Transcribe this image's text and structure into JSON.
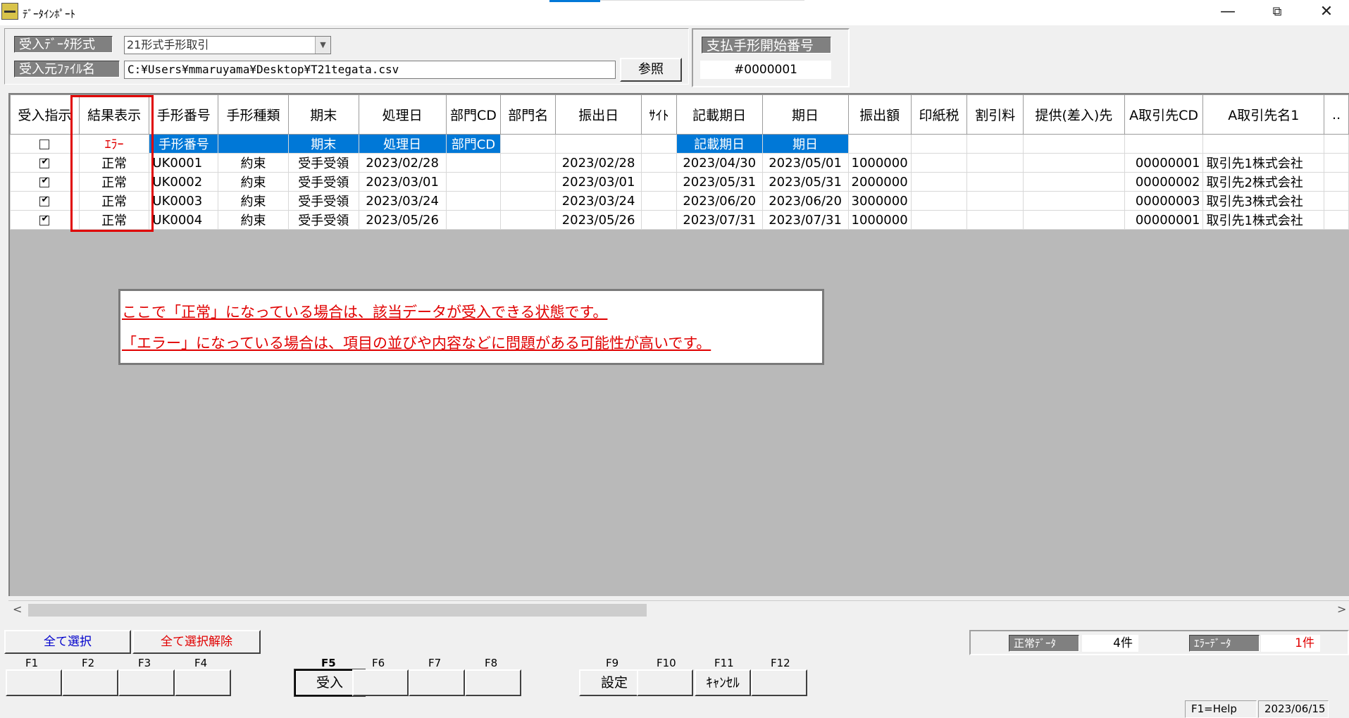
{
  "window": {
    "title": "ﾃﾞｰﾀｲﾝﾎﾟｰﾄ",
    "minimize": "—",
    "restore": "⧉",
    "close": "✕"
  },
  "header": {
    "format_label": "受入ﾃﾞｰﾀ形式",
    "format_value": "21形式手形取引",
    "file_label": "受入元ﾌｧｲﾙ名",
    "file_path": "C:¥Users¥mmaruyama¥Desktop¥T21tegata.csv",
    "browse_label": "参照",
    "start_no_label": "支払手形開始番号",
    "start_no_value": "#0000001"
  },
  "grid": {
    "columns": [
      "受入指示",
      "結果表示",
      "手形番号",
      "手形種類",
      "期末",
      "処理日",
      "部門CD",
      "部門名",
      "振出日",
      "ｻｲﾄ",
      "記載期日",
      "期日",
      "振出額",
      "印紙税",
      "割引料",
      "提供(差入)先",
      "A取引先CD",
      "A取引先名1",
      ".."
    ],
    "error_row": {
      "checked": false,
      "result": "ｴﾗｰ",
      "cells": [
        "手形番号",
        "",
        "期末",
        "処理日",
        "部門CD",
        "",
        "",
        "",
        "記載期日",
        "期日",
        "",
        "",
        "",
        "",
        "",
        "",
        ""
      ]
    },
    "rows": [
      {
        "checked": true,
        "result": "正常",
        "cells": [
          "UK0001",
          "約束",
          "受手受領",
          "2023/02/28",
          "",
          "",
          "2023/02/28",
          "",
          "2023/04/30",
          "2023/05/01",
          "1000000",
          "",
          "",
          "",
          "00000001",
          "取引先1株式会社",
          ""
        ]
      },
      {
        "checked": true,
        "result": "正常",
        "cells": [
          "UK0002",
          "約束",
          "受手受領",
          "2023/03/01",
          "",
          "",
          "2023/03/01",
          "",
          "2023/05/31",
          "2023/05/31",
          "2000000",
          "",
          "",
          "",
          "00000002",
          "取引先2株式会社",
          ""
        ]
      },
      {
        "checked": true,
        "result": "正常",
        "cells": [
          "UK0003",
          "約束",
          "受手受領",
          "2023/03/24",
          "",
          "",
          "2023/03/24",
          "",
          "2023/06/20",
          "2023/06/20",
          "3000000",
          "",
          "",
          "",
          "00000003",
          "取引先3株式会社",
          ""
        ]
      },
      {
        "checked": true,
        "result": "正常",
        "cells": [
          "UK0004",
          "約束",
          "受手受領",
          "2023/05/26",
          "",
          "",
          "2023/05/26",
          "",
          "2023/07/31",
          "2023/07/31",
          "1000000",
          "",
          "",
          "",
          "00000001",
          "取引先1株式会社",
          ""
        ]
      }
    ]
  },
  "note": {
    "line1": "ここで「正常」になっている場合は、該当データが受入できる状態です。",
    "line2": "「エラー」になっている場合は、項目の並びや内容などに問題がある可能性が高いです。"
  },
  "scroll": {
    "left_arrow": "<",
    "right_arrow": ">"
  },
  "footer": {
    "select_all": "全て選択",
    "deselect_all": "全て選択解除",
    "normal_label": "正常ﾃﾞｰﾀ",
    "normal_count": "4件",
    "error_label": "ｴﾗｰﾃﾞｰﾀ",
    "error_count": "1件",
    "fkeys": [
      "F1",
      "F2",
      "F3",
      "F4",
      "F5",
      "F6",
      "F7",
      "F8",
      "F9",
      "F10",
      "F11",
      "F12"
    ],
    "fbuttons": [
      "",
      "",
      "",
      "",
      "受入",
      "",
      "",
      "",
      "設定",
      "",
      "ｷｬﾝｾﾙ",
      ""
    ],
    "help": "F1=Help",
    "date": "2023/06/15"
  },
  "colors": {
    "error": "#e00000",
    "selection": "#0078d7",
    "select_all": "#0000cc"
  }
}
